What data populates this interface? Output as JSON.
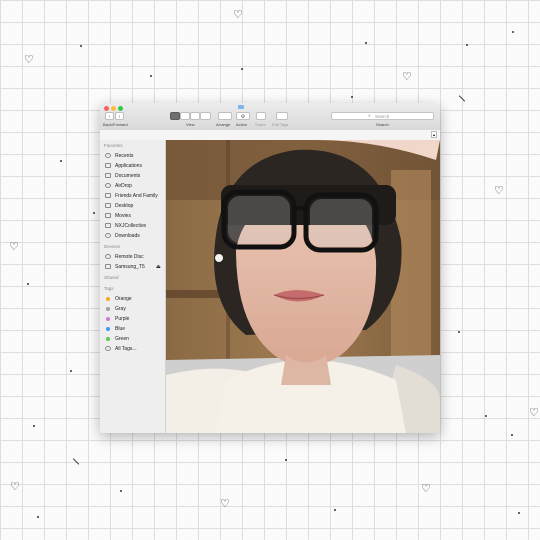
{
  "window": {
    "toolbar": {
      "back_forward_label": "Back/Forward",
      "view_label": "View",
      "arrange_label": "Arrange",
      "action_label": "Action",
      "share_label": "Share",
      "edit_tags_label": "Edit Tags",
      "search_label": "Search",
      "search_placeholder": "Search"
    },
    "sidebar": {
      "favorites_header": "Favorites",
      "favorites": [
        {
          "label": "Recents",
          "icon": "clock-icon"
        },
        {
          "label": "Applications",
          "icon": "applications-icon"
        },
        {
          "label": "Documents",
          "icon": "document-icon"
        },
        {
          "label": "AirDrop",
          "icon": "airdrop-icon"
        },
        {
          "label": "Friends And Family",
          "icon": "folder-icon"
        },
        {
          "label": "Desktop",
          "icon": "desktop-icon"
        },
        {
          "label": "Movies",
          "icon": "film-icon"
        },
        {
          "label": "NXJCollective",
          "icon": "folder-icon"
        },
        {
          "label": "Downloads",
          "icon": "download-icon"
        }
      ],
      "devices_header": "Devices",
      "devices": [
        {
          "label": "Remote Disc",
          "icon": "disc-icon"
        },
        {
          "label": "Samsung_T5",
          "icon": "drive-icon"
        }
      ],
      "shared_header": "Shared",
      "tags_header": "Tags",
      "tags": [
        {
          "label": "Orange",
          "color": "#f5a623"
        },
        {
          "label": "Gray",
          "color": "#a0a0a0"
        },
        {
          "label": "Purple",
          "color": "#c77ddb"
        },
        {
          "label": "Blue",
          "color": "#3b99fc"
        },
        {
          "label": "Green",
          "color": "#5ac94f"
        },
        {
          "label": "All Tags...",
          "color": ""
        }
      ]
    },
    "content": {
      "description": "selfie photo"
    }
  },
  "decor": {
    "heart_glyph": "♡"
  }
}
